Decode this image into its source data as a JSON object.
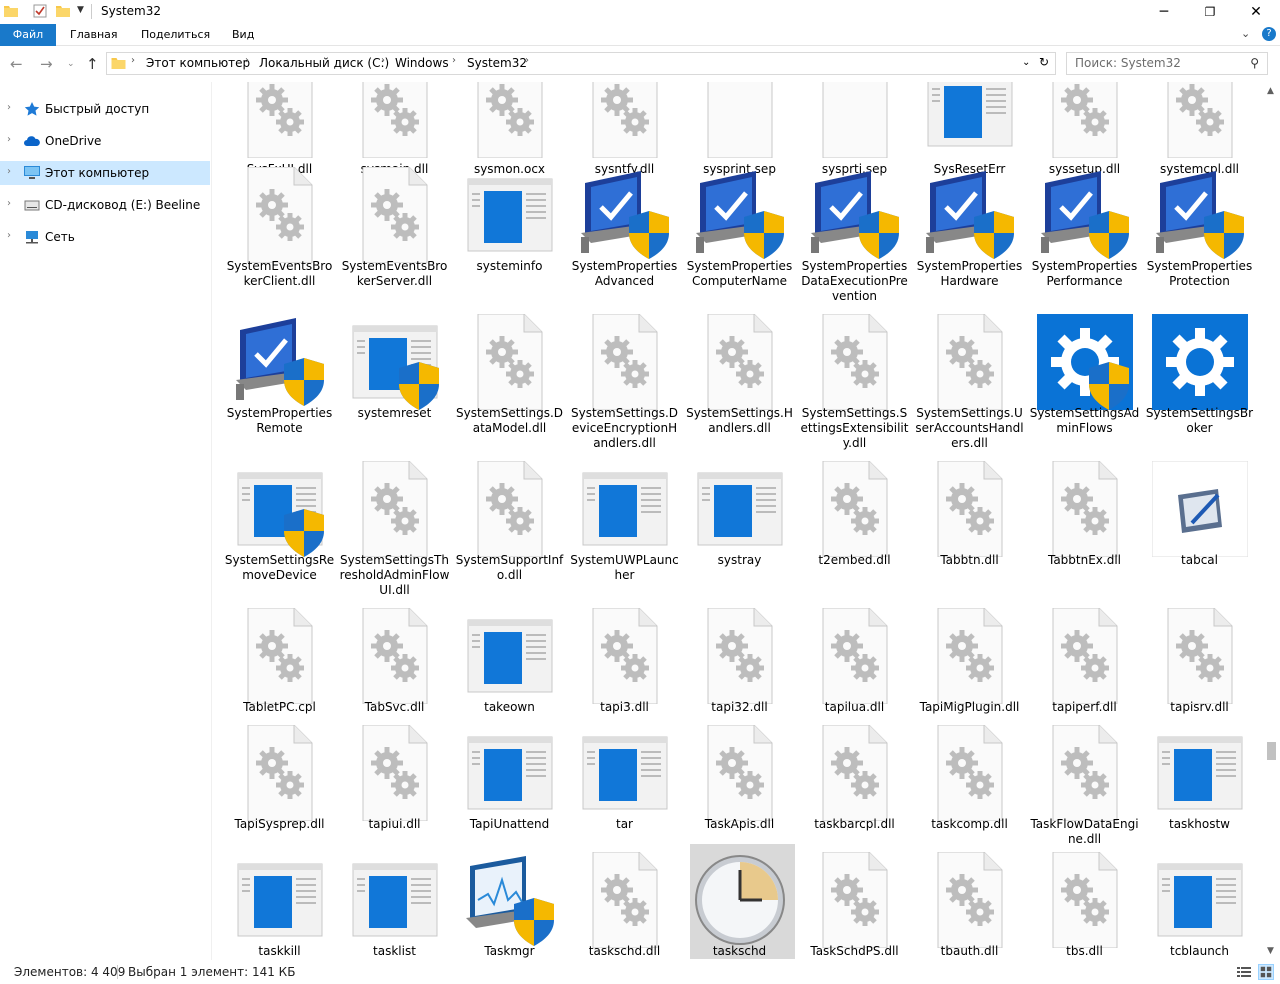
{
  "window": {
    "title": "System32"
  },
  "ribbon": {
    "tabs": [
      "Файл",
      "Главная",
      "Поделиться",
      "Вид"
    ]
  },
  "address": {
    "crumbs": [
      "Этот компьютер",
      "Локальный диск (C:)",
      "Windows",
      "System32"
    ]
  },
  "search": {
    "placeholder": "Поиск: System32"
  },
  "sidebar": {
    "items": [
      {
        "label": "Быстрый доступ",
        "icon": "star-icon"
      },
      {
        "label": "OneDrive",
        "icon": "cloud-icon"
      },
      {
        "label": "Этот компьютер",
        "icon": "computer-icon",
        "selected": true
      },
      {
        "label": "CD-дисковод (E:) Beeline",
        "icon": "cd-drive-icon"
      },
      {
        "label": "Сеть",
        "icon": "network-icon"
      }
    ]
  },
  "rows": [
    [
      {
        "name": "SysFxUI.dll",
        "type": "gear"
      },
      {
        "name": "sysmain.dll",
        "type": "gear"
      },
      {
        "name": "sysmon.ocx",
        "type": "gear"
      },
      {
        "name": "sysntfy.dll",
        "type": "gear"
      },
      {
        "name": "sysprint.sep",
        "type": "blank"
      },
      {
        "name": "sysprtj.sep",
        "type": "blank"
      },
      {
        "name": "SysResetErr",
        "type": "window"
      },
      {
        "name": "syssetup.dll",
        "type": "gear"
      },
      {
        "name": "systemcpl.dll",
        "type": "gear"
      }
    ],
    [
      {
        "name": "SystemEventsBrokerClient.dll",
        "type": "gear"
      },
      {
        "name": "SystemEventsBrokerServer.dll",
        "type": "gear"
      },
      {
        "name": "systeminfo",
        "type": "window"
      },
      {
        "name": "SystemPropertiesAdvanced",
        "type": "monitor"
      },
      {
        "name": "SystemPropertiesComputerName",
        "type": "monitor"
      },
      {
        "name": "SystemPropertiesDataExecutionPrevention",
        "type": "monitor"
      },
      {
        "name": "SystemPropertiesHardware",
        "type": "monitor"
      },
      {
        "name": "SystemPropertiesPerformance",
        "type": "monitor"
      },
      {
        "name": "SystemPropertiesProtection",
        "type": "monitor"
      }
    ],
    [
      {
        "name": "SystemPropertiesRemote",
        "type": "monitor"
      },
      {
        "name": "systemreset",
        "type": "window-shield"
      },
      {
        "name": "SystemSettings.DataModel.dll",
        "type": "gear"
      },
      {
        "name": "SystemSettings.DeviceEncryptionHandlers.dll",
        "type": "gear"
      },
      {
        "name": "SystemSettings.Handlers.dll",
        "type": "gear"
      },
      {
        "name": "SystemSettings.SettingsExtensibility.dll",
        "type": "gear"
      },
      {
        "name": "SystemSettings.UserAccountsHandlers.dll",
        "type": "gear"
      },
      {
        "name": "SystemSettingsAdminFlows",
        "type": "settings-shield"
      },
      {
        "name": "SystemSettingsBroker",
        "type": "settings"
      }
    ],
    [
      {
        "name": "SystemSettingsRemoveDevice",
        "type": "window-shield"
      },
      {
        "name": "SystemSettingsThresholdAdminFlowUI.dll",
        "type": "gear"
      },
      {
        "name": "SystemSupportInfo.dll",
        "type": "gear"
      },
      {
        "name": "SystemUWPLauncher",
        "type": "window"
      },
      {
        "name": "systray",
        "type": "window"
      },
      {
        "name": "t2embed.dll",
        "type": "gear"
      },
      {
        "name": "Tabbtn.dll",
        "type": "gear"
      },
      {
        "name": "TabbtnEx.dll",
        "type": "gear"
      },
      {
        "name": "tabcal",
        "type": "tabcal"
      }
    ],
    [
      {
        "name": "TabletPC.cpl",
        "type": "gear"
      },
      {
        "name": "TabSvc.dll",
        "type": "gear"
      },
      {
        "name": "takeown",
        "type": "window"
      },
      {
        "name": "tapi3.dll",
        "type": "gear"
      },
      {
        "name": "tapi32.dll",
        "type": "gear"
      },
      {
        "name": "tapilua.dll",
        "type": "gear"
      },
      {
        "name": "TapiMigPlugin.dll",
        "type": "gear"
      },
      {
        "name": "tapiperf.dll",
        "type": "gear"
      },
      {
        "name": "tapisrv.dll",
        "type": "gear"
      }
    ],
    [
      {
        "name": "TapiSysprep.dll",
        "type": "gear"
      },
      {
        "name": "tapiui.dll",
        "type": "gear"
      },
      {
        "name": "TapiUnattend",
        "type": "window"
      },
      {
        "name": "tar",
        "type": "window"
      },
      {
        "name": "TaskApis.dll",
        "type": "gear"
      },
      {
        "name": "taskbarcpl.dll",
        "type": "gear"
      },
      {
        "name": "taskcomp.dll",
        "type": "gear"
      },
      {
        "name": "TaskFlowDataEngine.dll",
        "type": "gear"
      },
      {
        "name": "taskhostw",
        "type": "window"
      }
    ],
    [
      {
        "name": "taskkill",
        "type": "window"
      },
      {
        "name": "tasklist",
        "type": "window"
      },
      {
        "name": "Taskmgr",
        "type": "taskmgr"
      },
      {
        "name": "taskschd.dll",
        "type": "gear"
      },
      {
        "name": "taskschd",
        "type": "clock",
        "selected": true
      },
      {
        "name": "TaskSchdPS.dll",
        "type": "gear"
      },
      {
        "name": "tbauth.dll",
        "type": "gear"
      },
      {
        "name": "tbs.dll",
        "type": "gear"
      },
      {
        "name": "tcblaunch",
        "type": "window"
      }
    ]
  ],
  "status": {
    "count": "Элементов: 4 409",
    "selection": "Выбран 1 элемент: 141 КБ"
  }
}
